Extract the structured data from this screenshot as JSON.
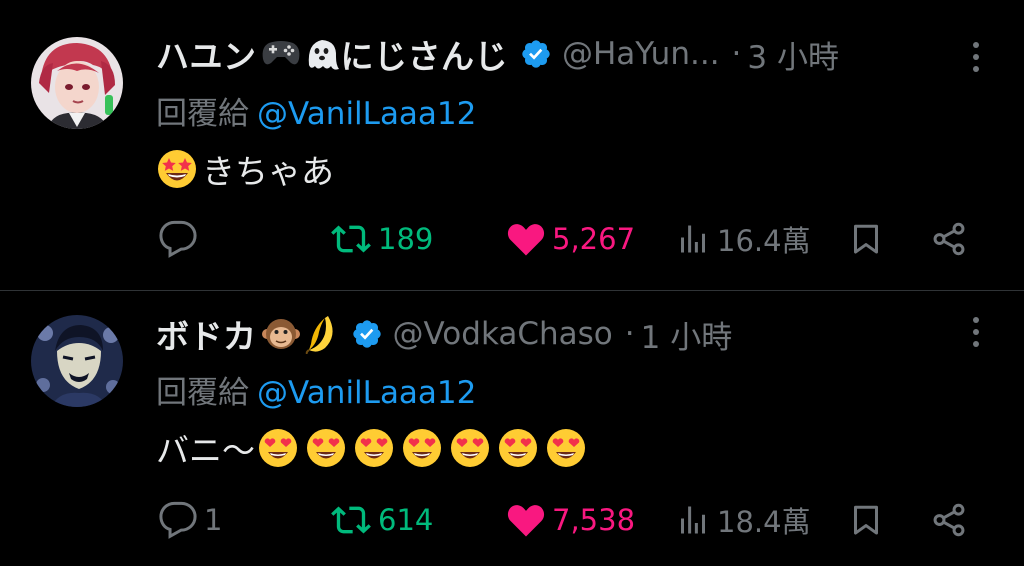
{
  "tweets": [
    {
      "name": "ハユン",
      "name_emojis": [
        "game-controller-icon",
        "ghost-icon"
      ],
      "name_suffix": "にじさんじ",
      "handle": "@HaYun...",
      "separator": "·",
      "time": "3 小時",
      "reply_prefix": "回覆給",
      "reply_to": "@VanilLaaa12",
      "body_text": "きちゃあ",
      "body_emojis_before": [
        "star-struck-emoji"
      ],
      "body_emojis_after": [],
      "reply_count": "",
      "retweet_count": "189",
      "like_count": "5,267",
      "view_count": "16.4萬"
    },
    {
      "name": "ボドカ",
      "name_emojis": [
        "monkey-emoji",
        "banana-emoji"
      ],
      "name_suffix": "",
      "handle": "@VodkaChaso",
      "separator": "·",
      "time": "1 小時",
      "reply_prefix": "回覆給",
      "reply_to": "@VanilLaaa12",
      "body_text": "バニ～",
      "body_emojis_before": [],
      "body_emojis_after": [
        "heart-eyes-emoji",
        "heart-eyes-emoji",
        "heart-eyes-emoji",
        "heart-eyes-emoji",
        "heart-eyes-emoji",
        "heart-eyes-emoji",
        "heart-eyes-emoji"
      ],
      "reply_count": "1",
      "retweet_count": "614",
      "like_count": "7,538",
      "view_count": "18.4萬"
    }
  ],
  "colors": {
    "background": "#000000",
    "text": "#e7e9ea",
    "muted": "#71767b",
    "link": "#1d9bf0",
    "retweet": "#00ba7c",
    "like": "#f91880",
    "verified": "#1d9bf0"
  }
}
